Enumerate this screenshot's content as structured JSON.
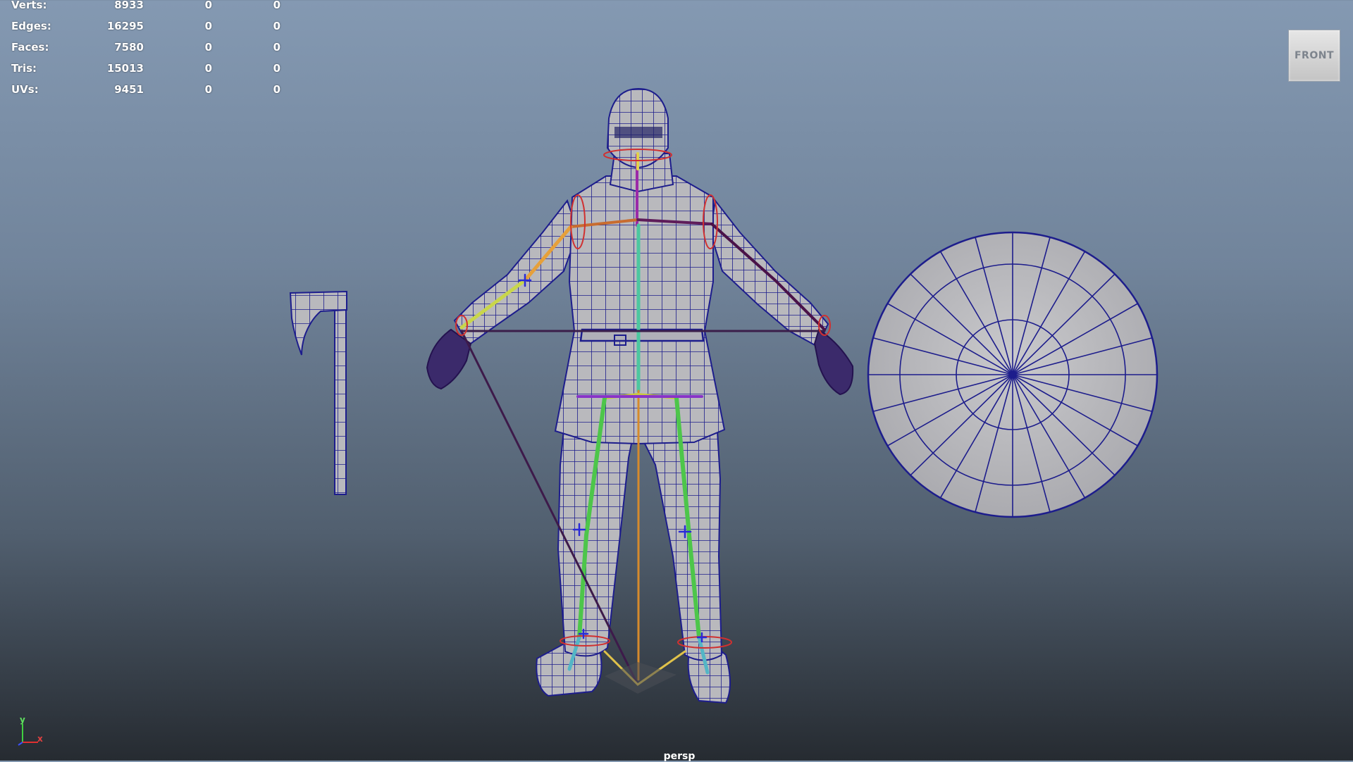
{
  "viewport": {
    "camera": "persp",
    "view_cube_label": "FRONT"
  },
  "stats": {
    "rows": [
      {
        "label": "Verts:",
        "values": [
          "8933",
          "0",
          "0"
        ]
      },
      {
        "label": "Edges:",
        "values": [
          "16295",
          "0",
          "0"
        ]
      },
      {
        "label": "Faces:",
        "values": [
          "7580",
          "0",
          "0"
        ]
      },
      {
        "label": "Tris:",
        "values": [
          "15013",
          "0",
          "0"
        ]
      },
      {
        "label": "UVs:",
        "values": [
          "9451",
          "0",
          "0"
        ]
      }
    ]
  },
  "axis_indicator": {
    "y_label": "y",
    "x_label": "x"
  },
  "colors": {
    "wire": "#1a1a8a",
    "mesh": "#b8b8bc",
    "background_top": "#8499b2",
    "background_bottom": "#262b31"
  }
}
